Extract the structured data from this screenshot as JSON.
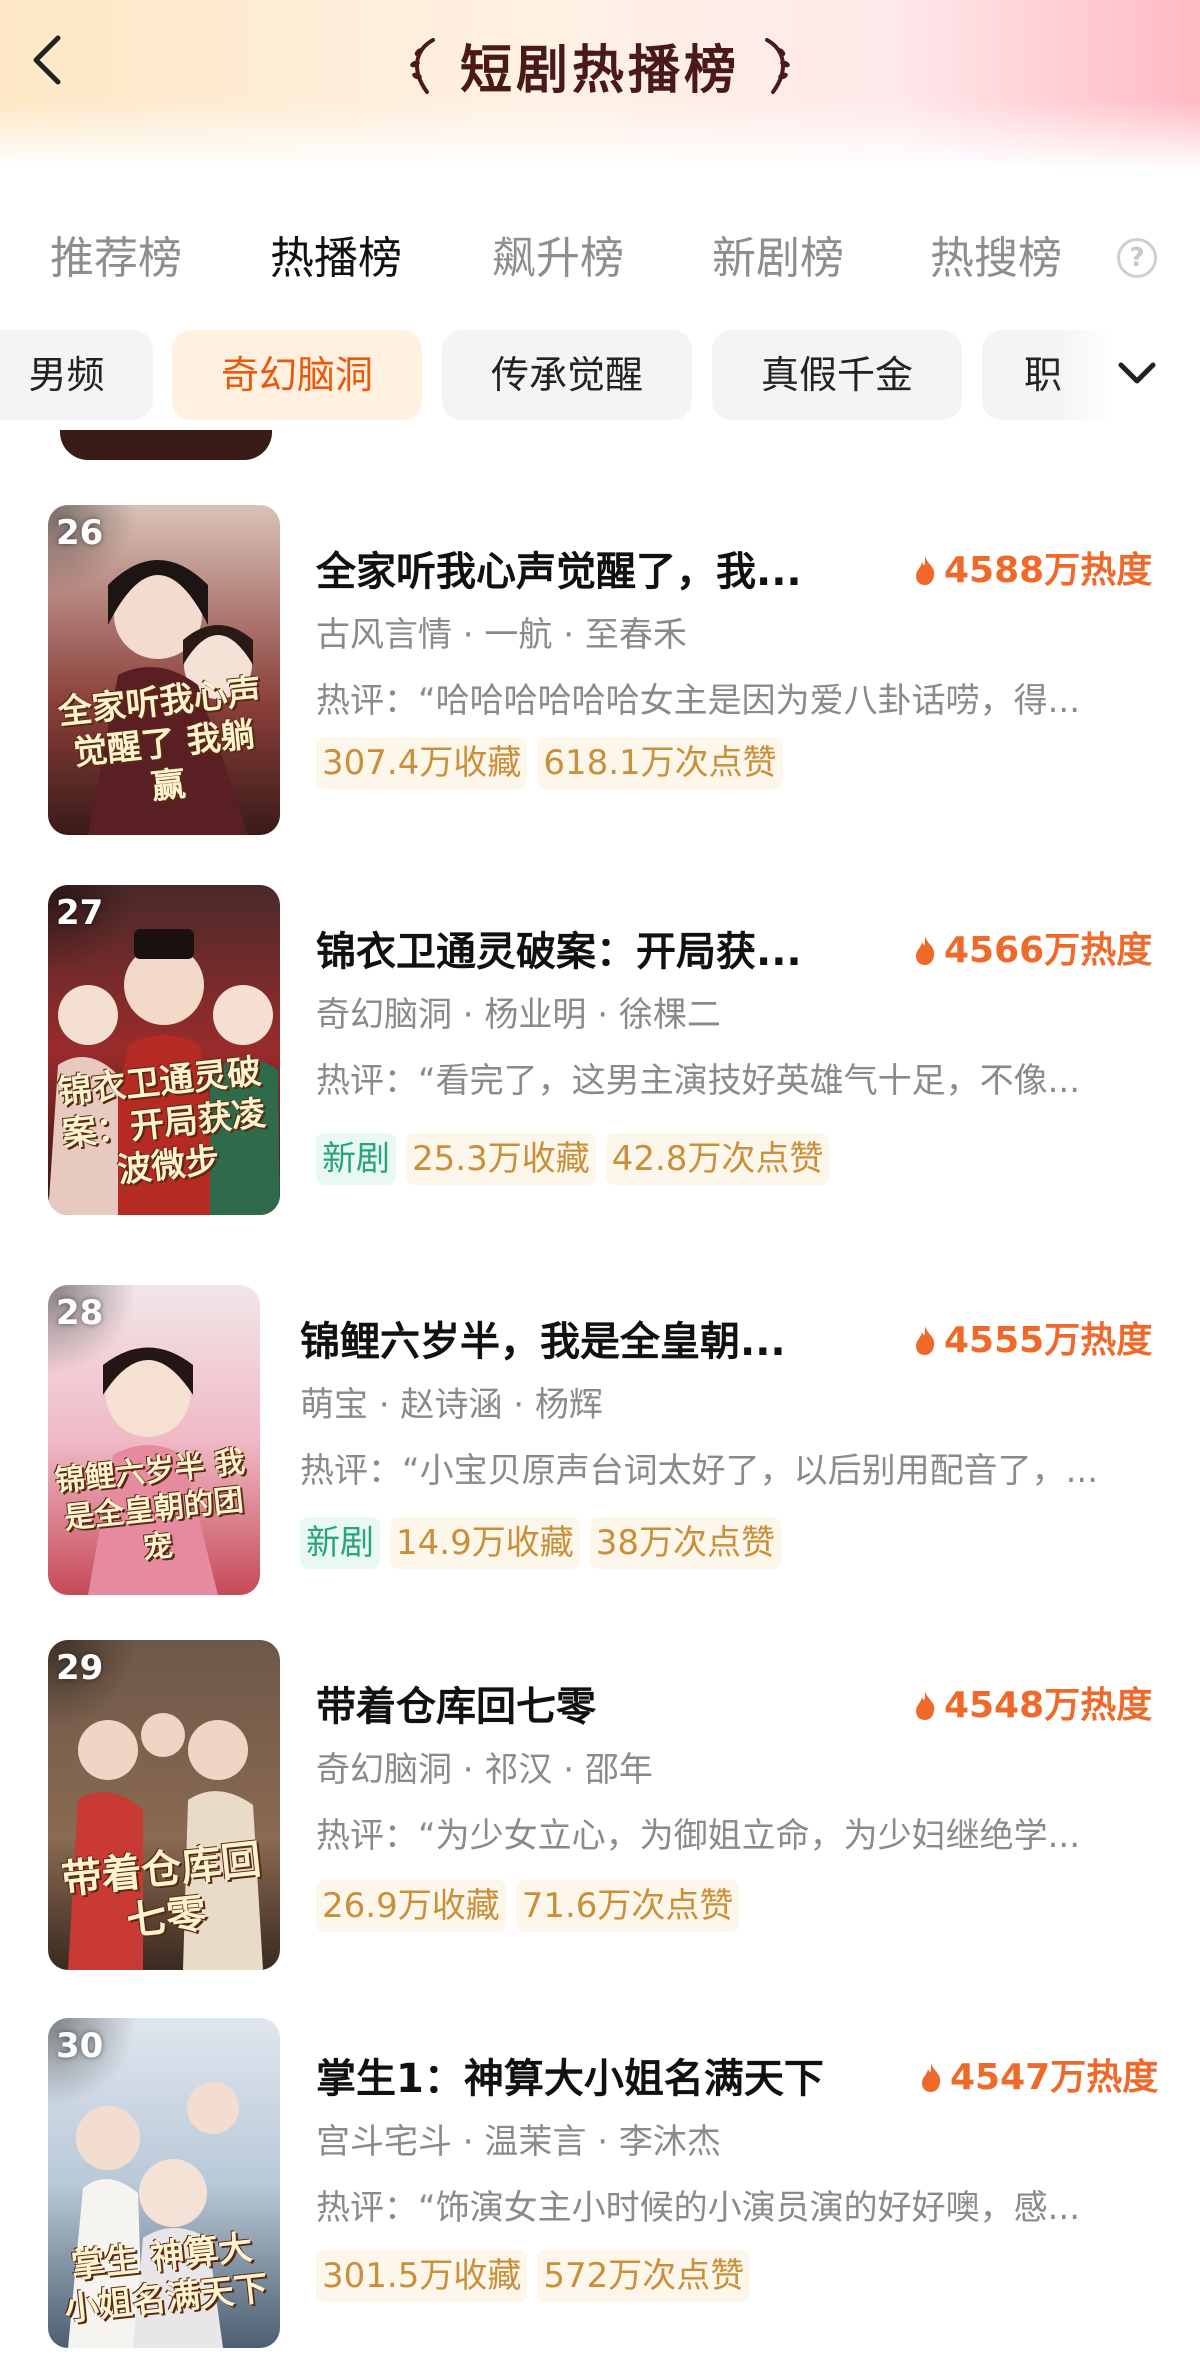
{
  "header": {
    "back_icon": "chevron-left-icon",
    "title": "短剧热播榜",
    "laurel_icon": "laurel-icon"
  },
  "rank_tabs": [
    {
      "label": "推荐榜",
      "active": false
    },
    {
      "label": "热播榜",
      "active": true
    },
    {
      "label": "飙升榜",
      "active": false
    },
    {
      "label": "新剧榜",
      "active": false
    },
    {
      "label": "热搜榜",
      "active": false
    }
  ],
  "help_icon": "?",
  "categories": [
    {
      "label": "男频",
      "active": false
    },
    {
      "label": "奇幻脑洞",
      "active": true
    },
    {
      "label": "传承觉醒",
      "active": false
    },
    {
      "label": "真假千金",
      "active": false
    },
    {
      "label": "职",
      "active": false
    }
  ],
  "expand_icon": "chevron-down-icon",
  "colors": {
    "accent": "#ef6a2a",
    "title": "#4a1a1a",
    "tag_gold_bg": "#fdf6ea",
    "tag_gold_text": "#c9903b",
    "tag_new_bg": "#eaf8f2",
    "tag_new_text": "#2aa57a"
  },
  "items": [
    {
      "rank": "26",
      "title": "全家听我心声觉醒了，我...",
      "heat": "4588万热度",
      "meta": "古风言情 · 一航 · 至春禾",
      "review": "热评：“哈哈哈哈哈哈女主是因为爱八卦话唠，得...",
      "new_tag": "",
      "collect": "307.4万收藏",
      "likes": "618.1万次点赞",
      "poster_caption": "全家听我心声觉醒了 我躺赢"
    },
    {
      "rank": "27",
      "title": "锦衣卫通灵破案：开局获...",
      "heat": "4566万热度",
      "meta": "奇幻脑洞 · 杨业明 · 徐棵二",
      "review": "热评：“看完了，这男主演技好英雄气十足，不像...",
      "new_tag": "新剧",
      "collect": "25.3万收藏",
      "likes": "42.8万次点赞",
      "poster_caption": "锦衣卫通灵破案：开局获凌波微步"
    },
    {
      "rank": "28",
      "title": "锦鲤六岁半，我是全皇朝...",
      "heat": "4555万热度",
      "meta": "萌宝 · 赵诗涵 · 杨辉",
      "review": "热评：“小宝贝原声台词太好了，以后别用配音了，...",
      "new_tag": "新剧",
      "collect": "14.9万收藏",
      "likes": "38万次点赞",
      "poster_caption": "锦鲤六岁半 我是全皇朝的团宠"
    },
    {
      "rank": "29",
      "title": "带着仓库回七零",
      "heat": "4548万热度",
      "meta": "奇幻脑洞 · 祁汉 · 邵年",
      "review": "热评：“为少女立心，为御姐立命，为少妇继绝学...",
      "new_tag": "",
      "collect": "26.9万收藏",
      "likes": "71.6万次点赞",
      "poster_caption": "带着仓库回七零"
    },
    {
      "rank": "30",
      "title": "掌生1：神算大小姐名满天下",
      "heat": "4547万热度",
      "meta": "宫斗宅斗 · 温茉言 · 李沐杰",
      "review": "热评：“饰演女主小时候的小演员演的好好噢，感...",
      "new_tag": "",
      "collect": "301.5万收藏",
      "likes": "572万次点赞",
      "poster_caption": "掌生 神算大小姐名满天下"
    }
  ]
}
